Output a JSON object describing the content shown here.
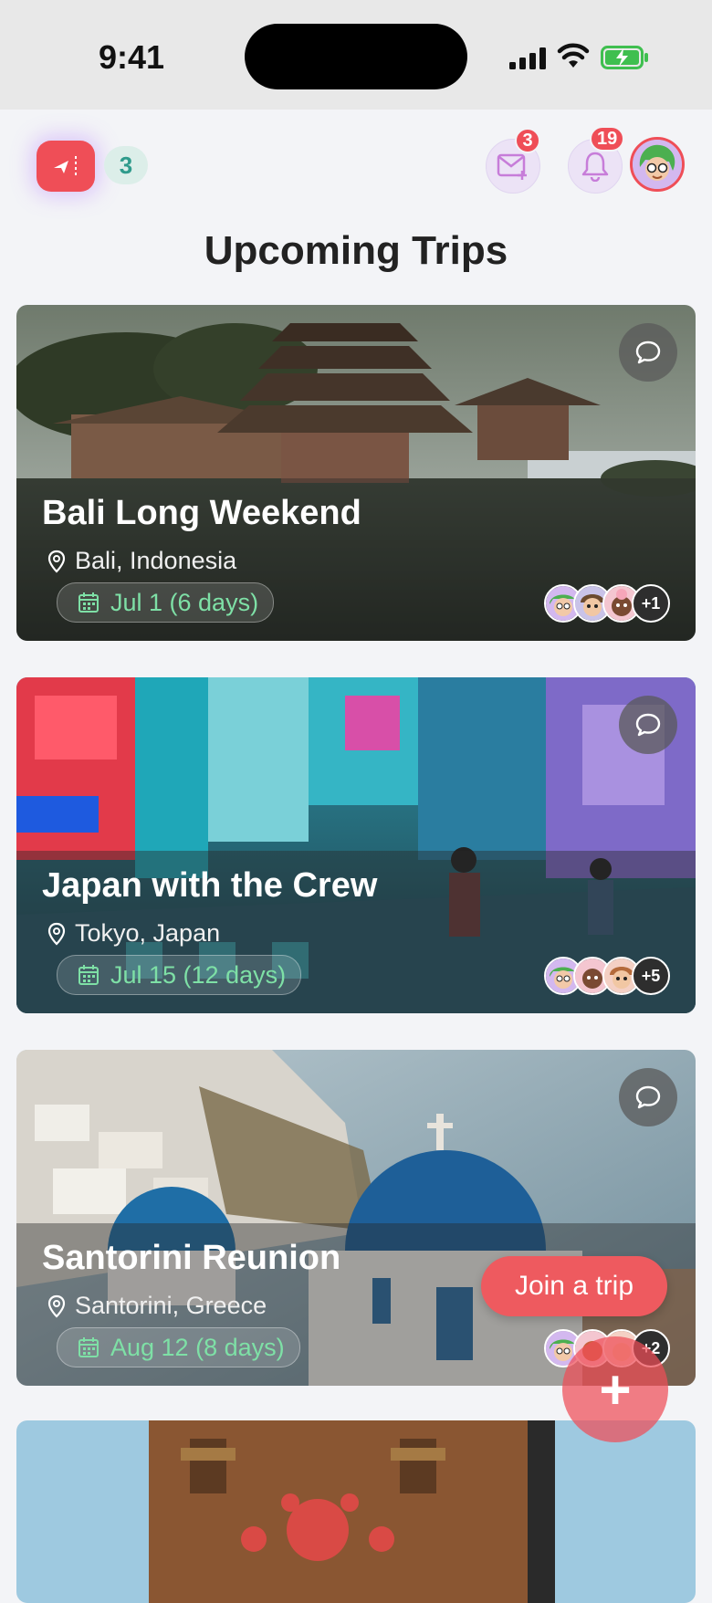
{
  "status_bar": {
    "time": "9:41"
  },
  "header": {
    "trip_count": "3",
    "mail_badge": "3",
    "notifications_badge": "19",
    "icons": [
      "ticket-plane-icon",
      "mail-plus-icon",
      "bell-icon",
      "avatar"
    ]
  },
  "page": {
    "title": "Upcoming Trips"
  },
  "trips": [
    {
      "title": "Bali Long Weekend",
      "location": "Bali, Indonesia",
      "date": "Jul 1 (6 days)",
      "more_members": "+1"
    },
    {
      "title": "Japan with the Crew",
      "location": "Tokyo, Japan",
      "date": "Jul 15 (12 days)",
      "more_members": "+5"
    },
    {
      "title": "Santorini Reunion",
      "location": "Santorini, Greece",
      "date": "Aug 12 (8 days)",
      "more_members": "+2"
    }
  ],
  "actions": {
    "join_label": "Join a trip",
    "add_label": "+"
  },
  "colors": {
    "accent": "#ef4e57",
    "date_text": "#7ee0a6",
    "count_text": "#2f9b8c"
  }
}
